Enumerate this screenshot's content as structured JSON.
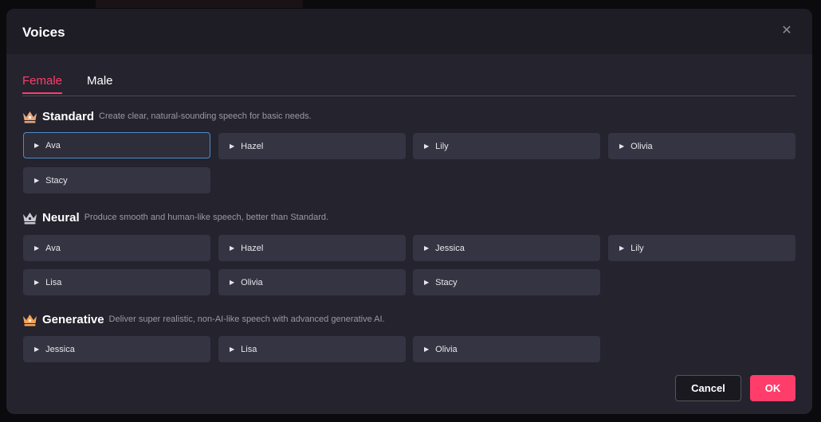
{
  "dialog": {
    "title": "Voices"
  },
  "tabs": [
    {
      "label": "Female"
    },
    {
      "label": "Male"
    }
  ],
  "colors": {
    "accent": "#ff3d6b",
    "selected_border": "#4f8cc9",
    "crown_standard": "#e8a67a",
    "crown_neural": "#c9c9d2",
    "crown_generative": "#f2a45a"
  },
  "sections": [
    {
      "name": "Standard",
      "description": "Create clear, natural-sounding speech for basic needs.",
      "icon": "crown-icon",
      "voices": [
        "Ava",
        "Hazel",
        "Lily",
        "Olivia",
        "Stacy"
      ]
    },
    {
      "name": "Neural",
      "description": "Produce smooth and human-like speech, better than Standard.",
      "icon": "crown-icon",
      "voices": [
        "Ava",
        "Hazel",
        "Jessica",
        "Lily",
        "Lisa",
        "Olivia",
        "Stacy"
      ]
    },
    {
      "name": "Generative",
      "description": "Deliver super realistic, non-AI-like speech with advanced generative AI.",
      "icon": "crown-icon",
      "voices": [
        "Jessica",
        "Lisa",
        "Olivia"
      ]
    }
  ],
  "selected_voice": "Standard / Ava",
  "footer": {
    "cancel_label": "Cancel",
    "ok_label": "OK"
  }
}
